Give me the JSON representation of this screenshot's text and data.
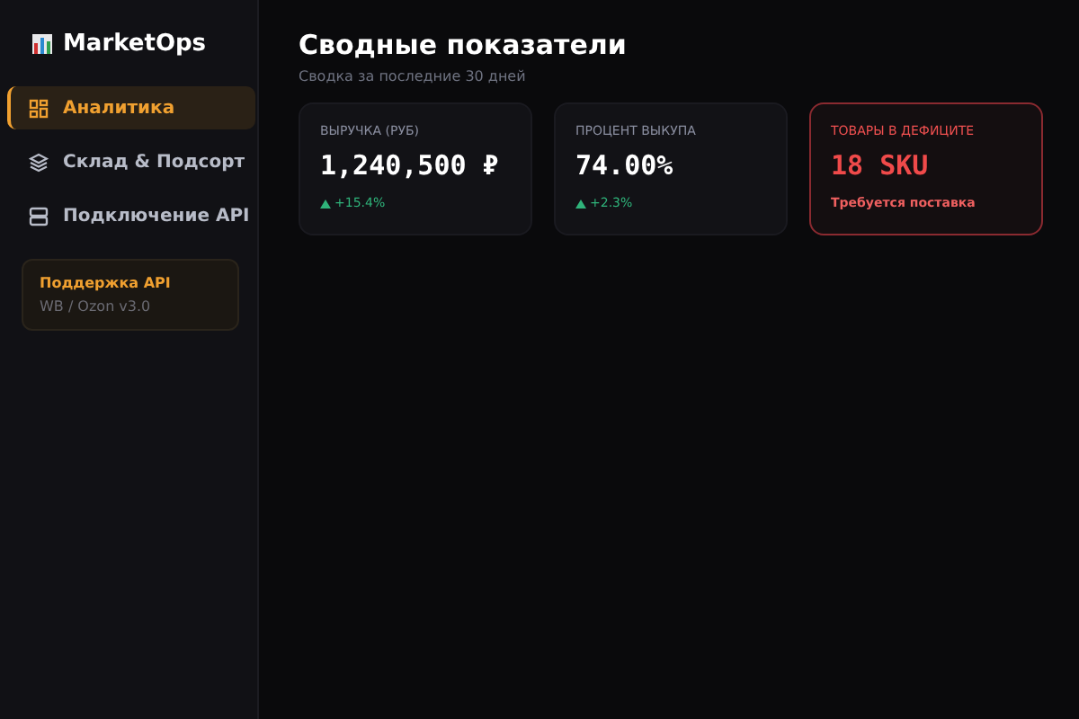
{
  "brand": {
    "name": "MarketOps"
  },
  "nav": [
    {
      "label": "Аналитика",
      "selected": true
    },
    {
      "label": "Склад & Подсорт",
      "selected": false
    },
    {
      "label": "Подключение API",
      "selected": false
    }
  ],
  "support": {
    "title": "Поддержка API",
    "subtitle": "WB / Ozon v3.0"
  },
  "header": {
    "title": "Сводные показатели",
    "subtitle": "Сводка за последние 30 дней"
  },
  "cards": [
    {
      "kind": "metric",
      "label": "ВЫРУЧКА (РУБ)",
      "value": "1,240,500 ₽",
      "trend": "+15.4%"
    },
    {
      "kind": "metric",
      "label": "ПРОЦЕНТ ВЫКУПА",
      "value": "74.00%",
      "trend": "+2.3%"
    },
    {
      "kind": "alert",
      "label": "ТОВАРЫ В ДЕФИЦИТЕ",
      "value": "18 SKU",
      "note": "Требуется поставка"
    }
  ]
}
